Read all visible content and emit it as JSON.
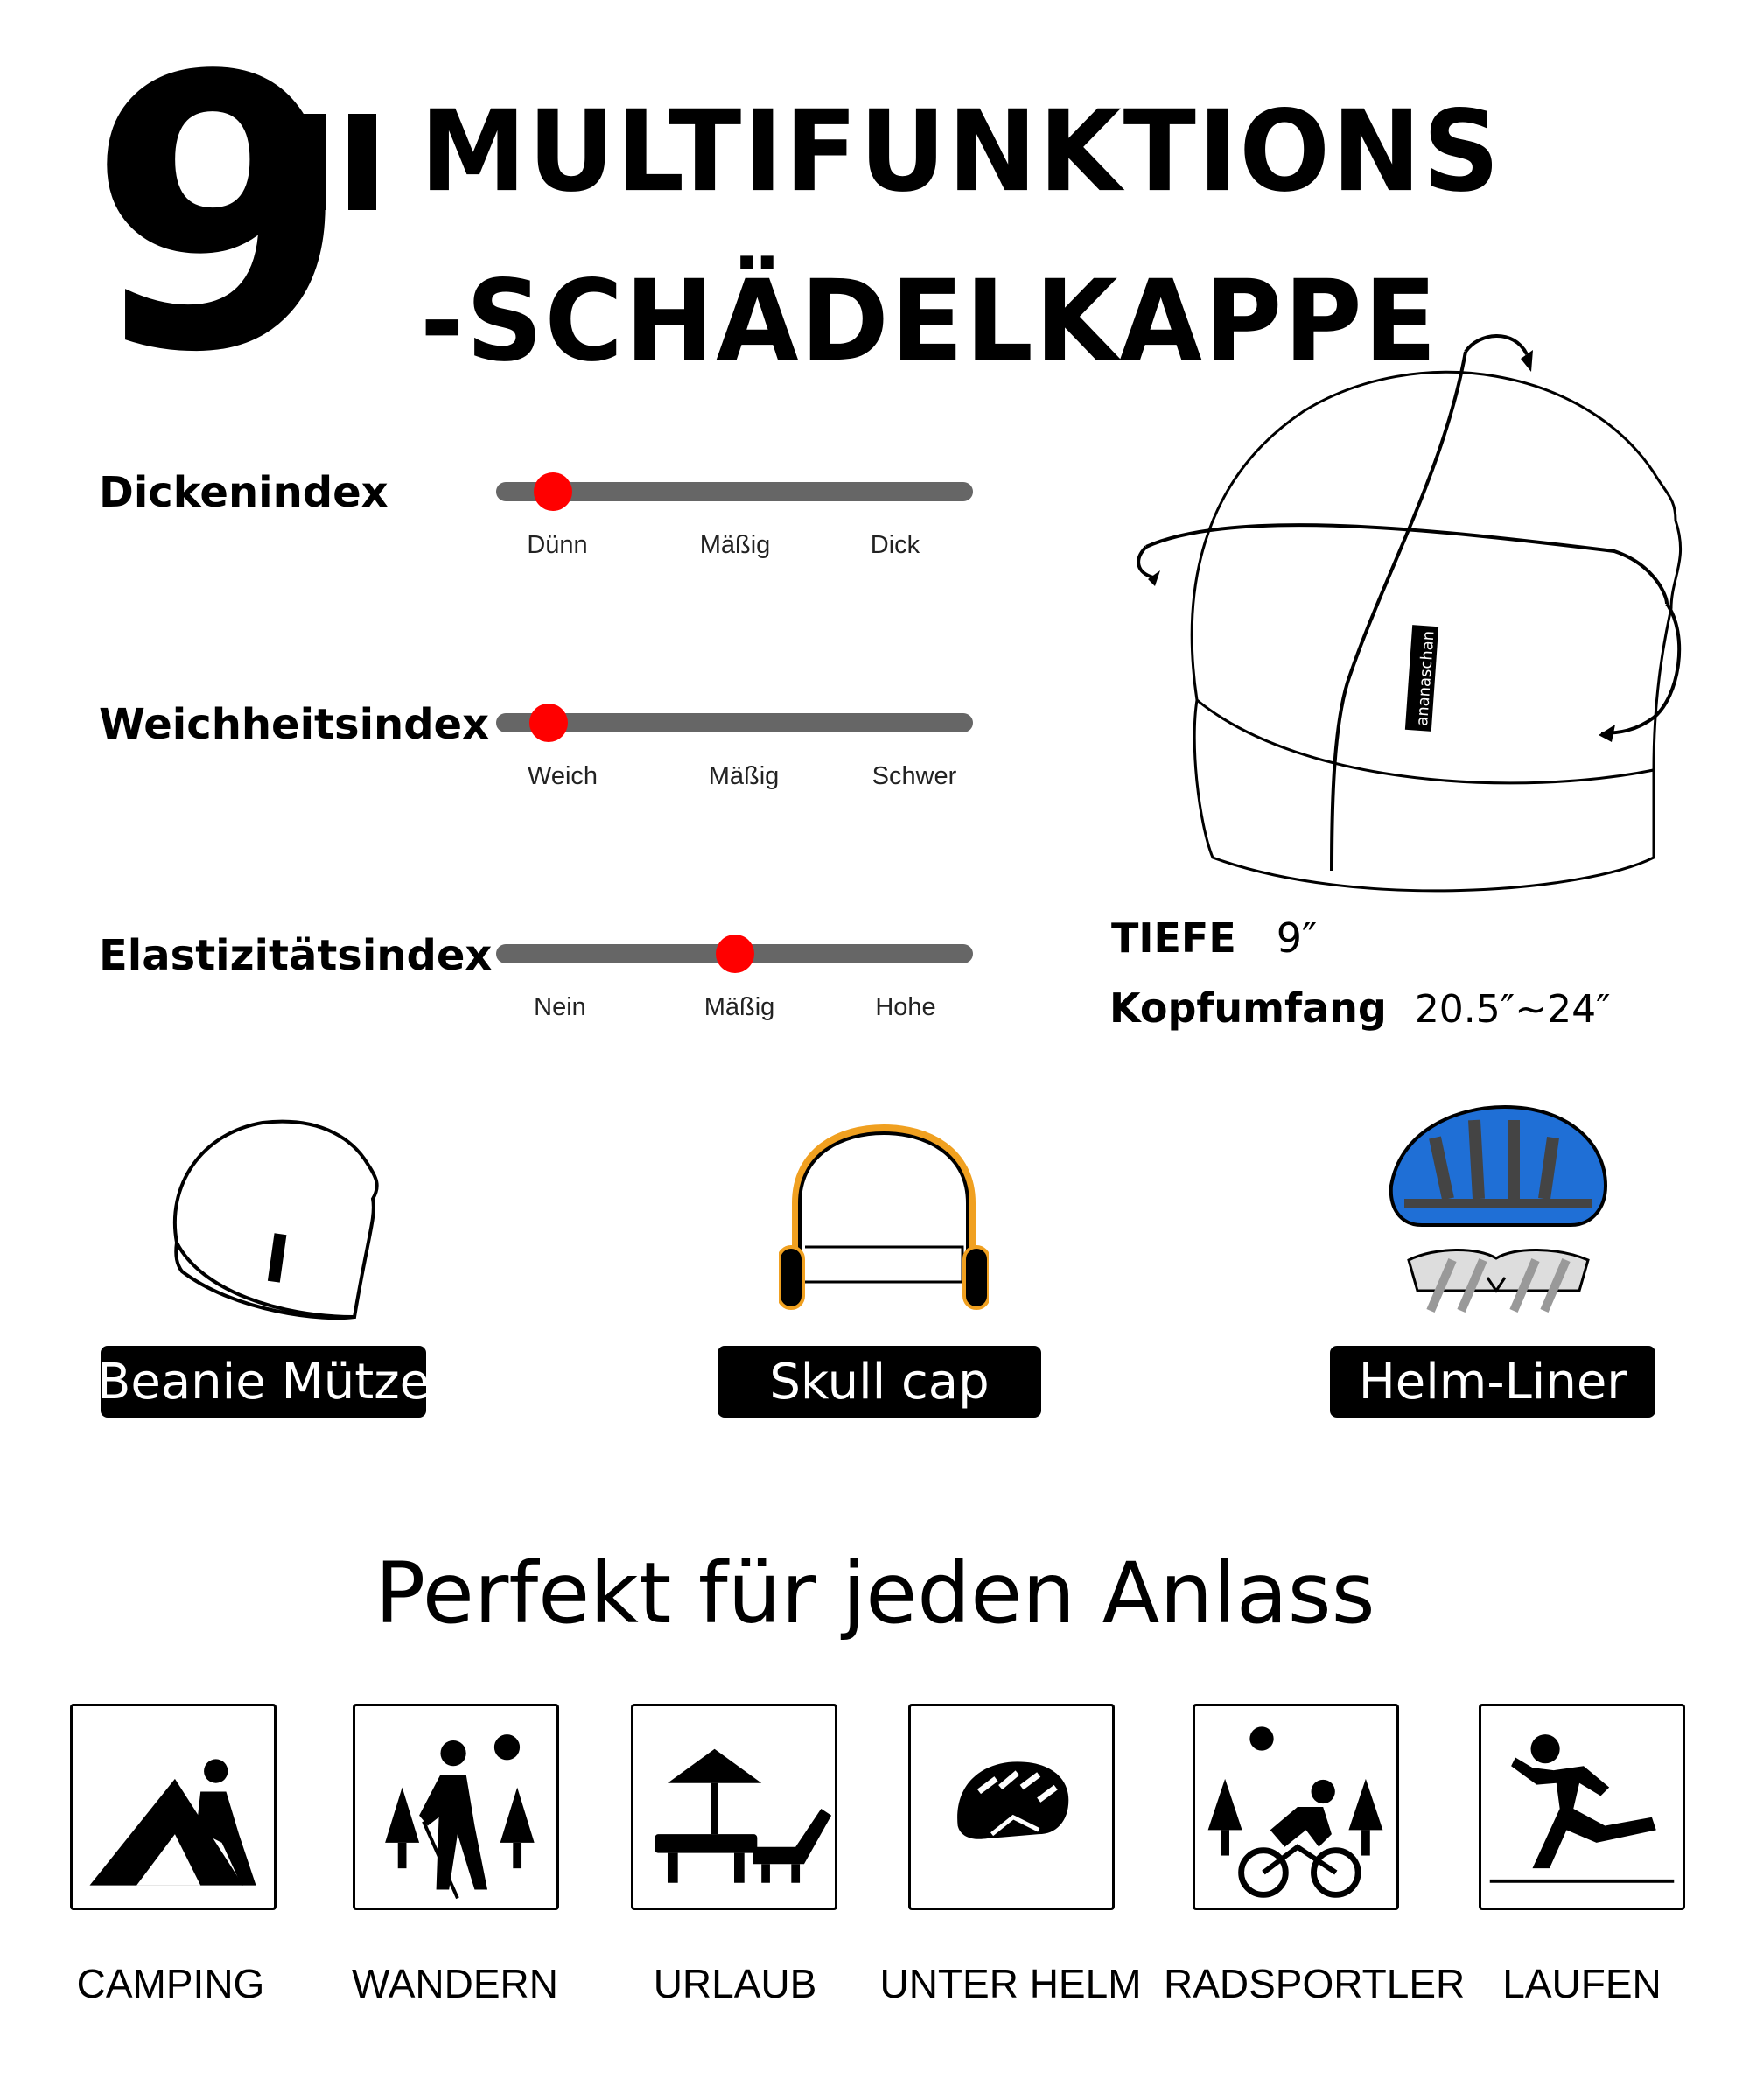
{
  "header": {
    "depth_number": "9",
    "depth_mark": "\"",
    "title_line_1": "MULTIFUNKTIONS",
    "title_line_2": "-SCHÄDELKAPPE"
  },
  "indices": [
    {
      "label": "Dickenindex",
      "ticks": [
        "Dünn",
        "Mäßig",
        "Dick"
      ],
      "level": 0.12
    },
    {
      "label": "Weichheitsindex",
      "ticks": [
        "Weich",
        "Mäßig",
        "Schwer"
      ],
      "level": 0.11
    },
    {
      "label": "Elastizitätsindex",
      "ticks": [
        "Nein",
        "Mäßig",
        "Hohe"
      ],
      "level": 0.5
    }
  ],
  "specs": {
    "depth_label": "TIEFE",
    "depth_value": "9″",
    "circumference_label": "Kopfumfang",
    "circumference_value": "20.5″~24″"
  },
  "product": {
    "tag_text": "ananaschan"
  },
  "uses": [
    {
      "label": "Beanie Mütze",
      "icon": "beanie-icon"
    },
    {
      "label": "Skull cap",
      "icon": "earmuff-icon"
    },
    {
      "label": "Helm-Liner",
      "icon": "helmet-goggles-icon"
    }
  ],
  "occasion_heading": "Perfekt für jeden Anlass",
  "activities": [
    {
      "label": "CAMPING",
      "icon": "camping-icon"
    },
    {
      "label": "WANDERN",
      "icon": "hiking-icon"
    },
    {
      "label": "URLAUB",
      "icon": "vacation-icon"
    },
    {
      "label": "UNTER HELM",
      "icon": "helmet-icon"
    },
    {
      "label": "RADSPORTLER",
      "icon": "cycling-icon"
    },
    {
      "label": "LAUFEN",
      "icon": "running-icon"
    }
  ],
  "colors": {
    "slider_knob": "#ff0000",
    "slider_track": "#666666",
    "helmet_blue": "#1f6fd6",
    "earmuff_orange": "#f0a020"
  }
}
